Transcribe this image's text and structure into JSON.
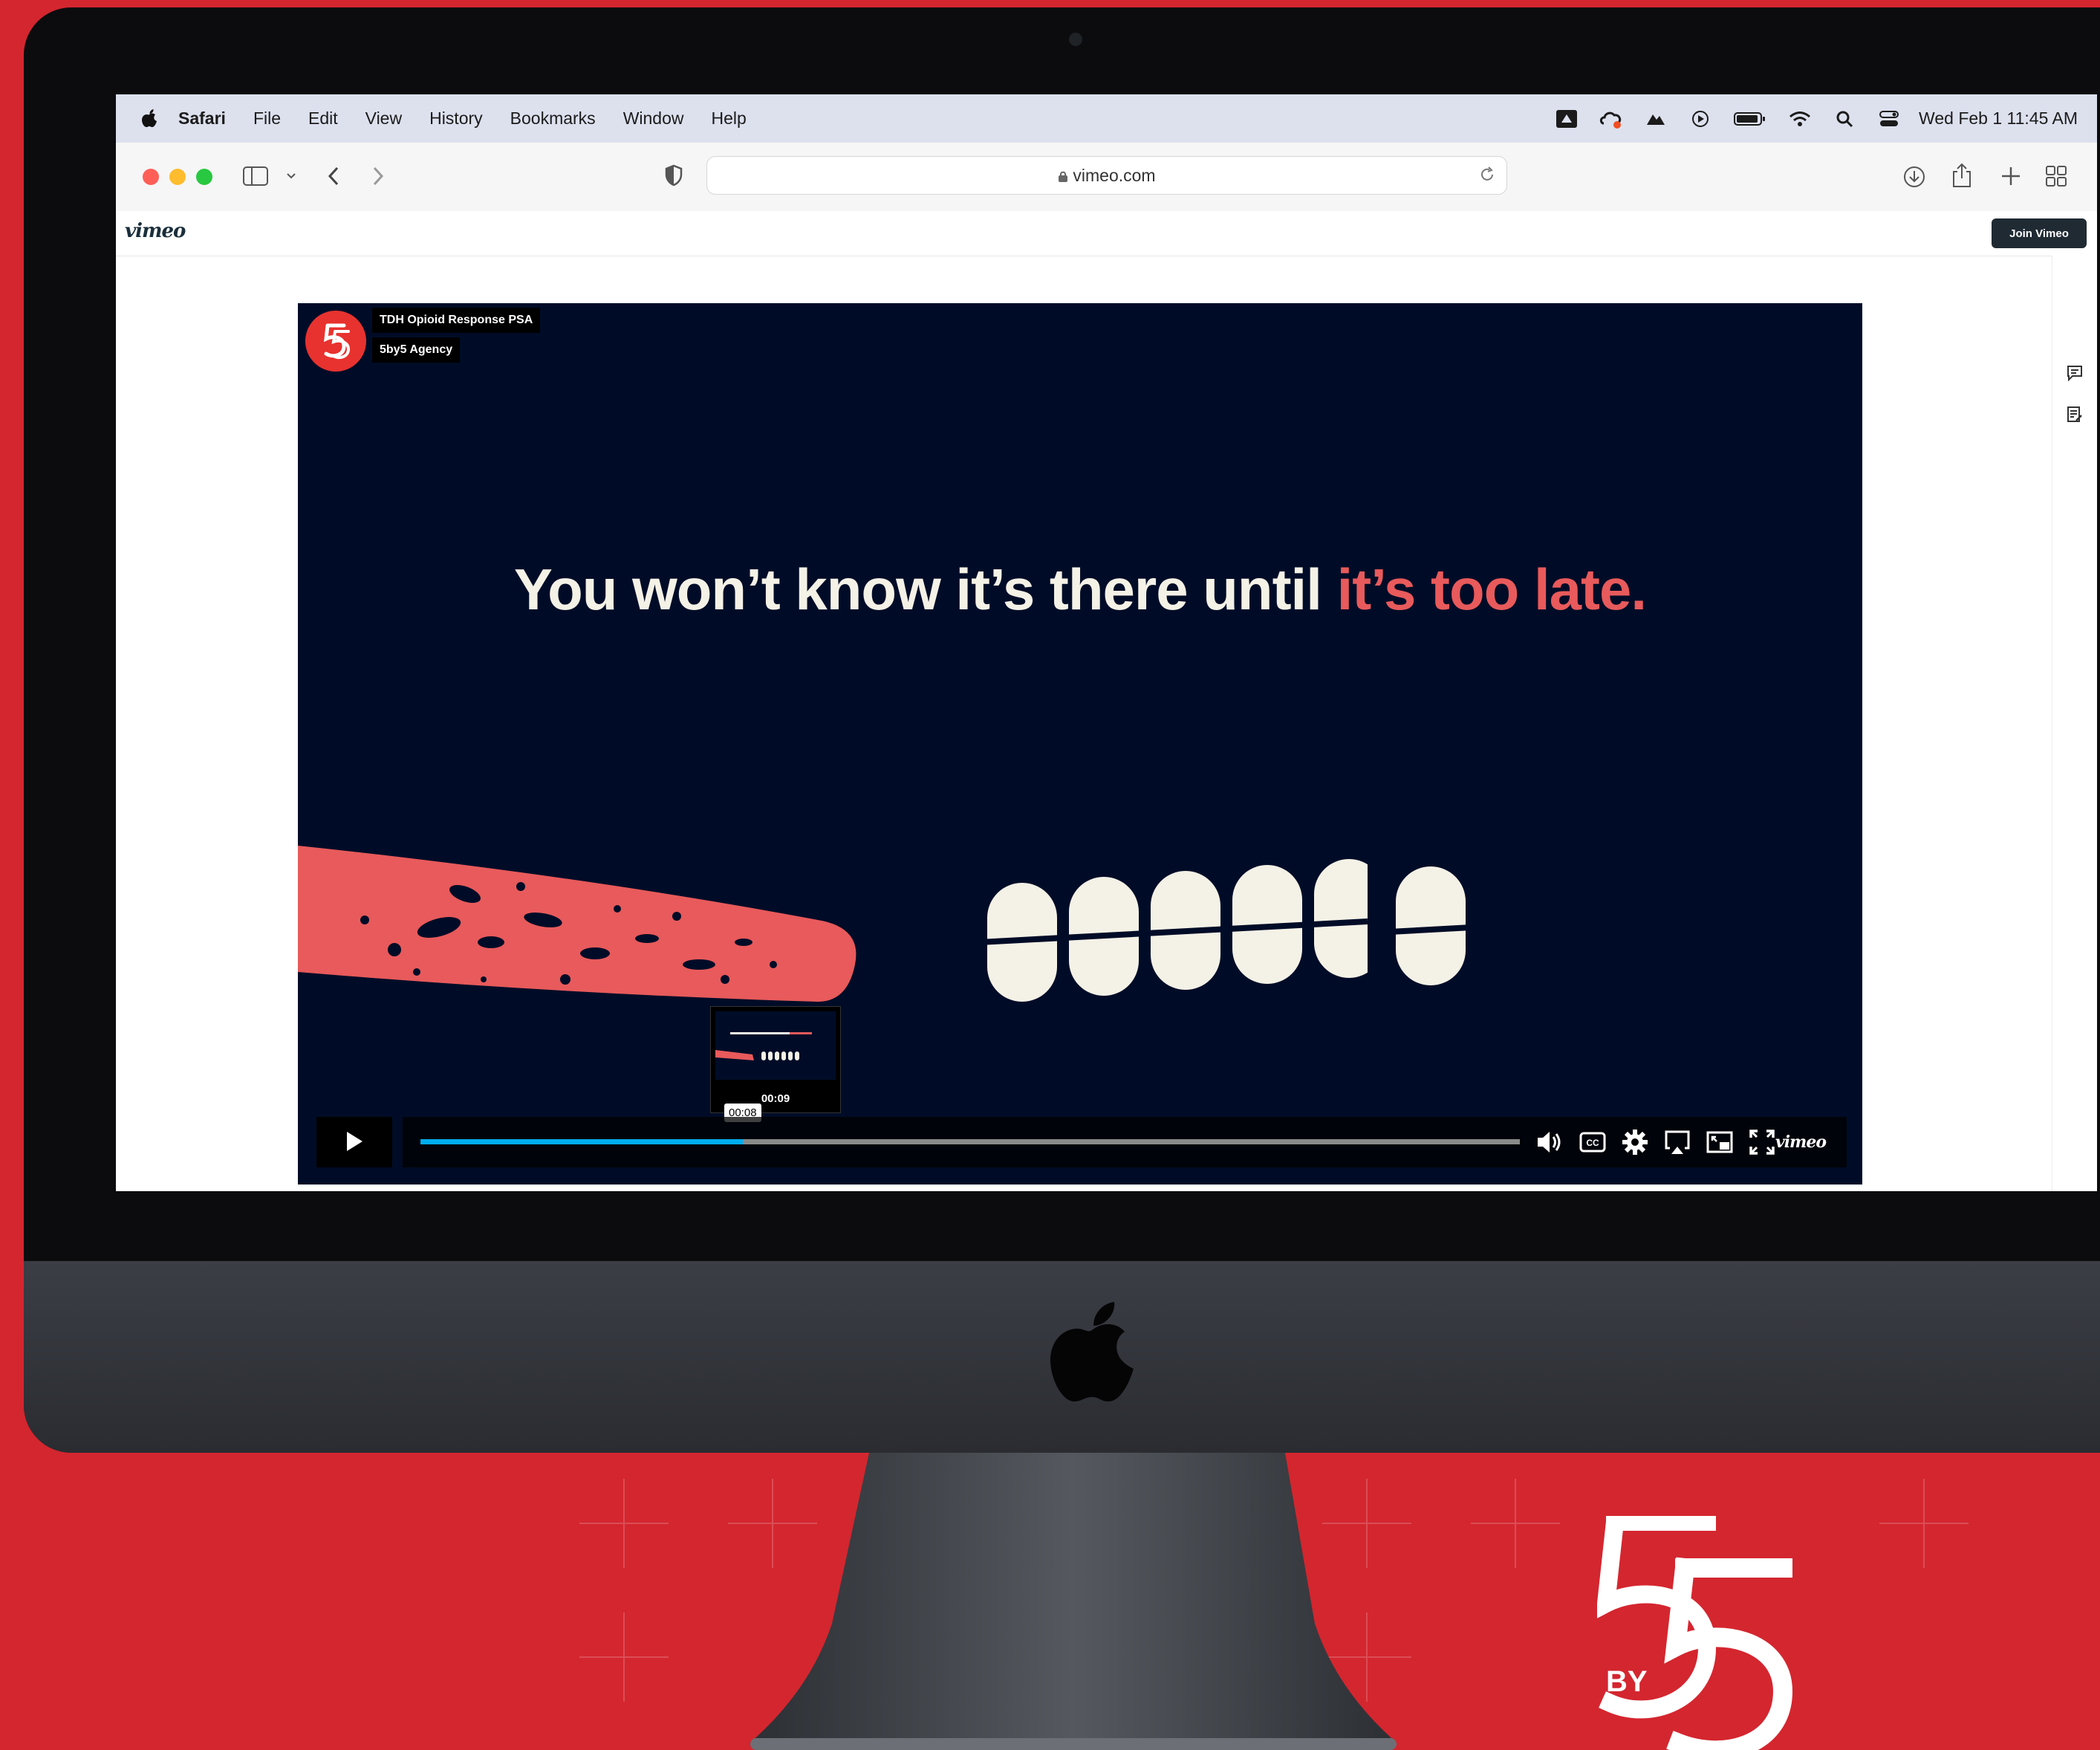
{
  "menubar": {
    "app_name": "Safari",
    "items": [
      "File",
      "Edit",
      "View",
      "History",
      "Bookmarks",
      "Window",
      "Help"
    ],
    "datetime": "Wed Feb 1  11:45 AM"
  },
  "safari": {
    "url": "vimeo.com"
  },
  "vimeo": {
    "logo": "vimeo",
    "join_label": "Join Vimeo"
  },
  "video": {
    "title": "TDH Opioid Response PSA",
    "channel": "5by5 Agency",
    "headline_main": "You won’t know it’s there until ",
    "headline_accent": "it’s too late.",
    "preview_time": "00:09",
    "hover_time": "00:08",
    "progress": 0.293,
    "vimeo_mark": "vimeo"
  },
  "brand": {
    "by": "BY"
  },
  "colors": {
    "background": "#d4262f",
    "player_bg": "#000c27",
    "accent": "#e85a5b",
    "progress": "#00adef",
    "tooth": "#f4f1e6"
  }
}
